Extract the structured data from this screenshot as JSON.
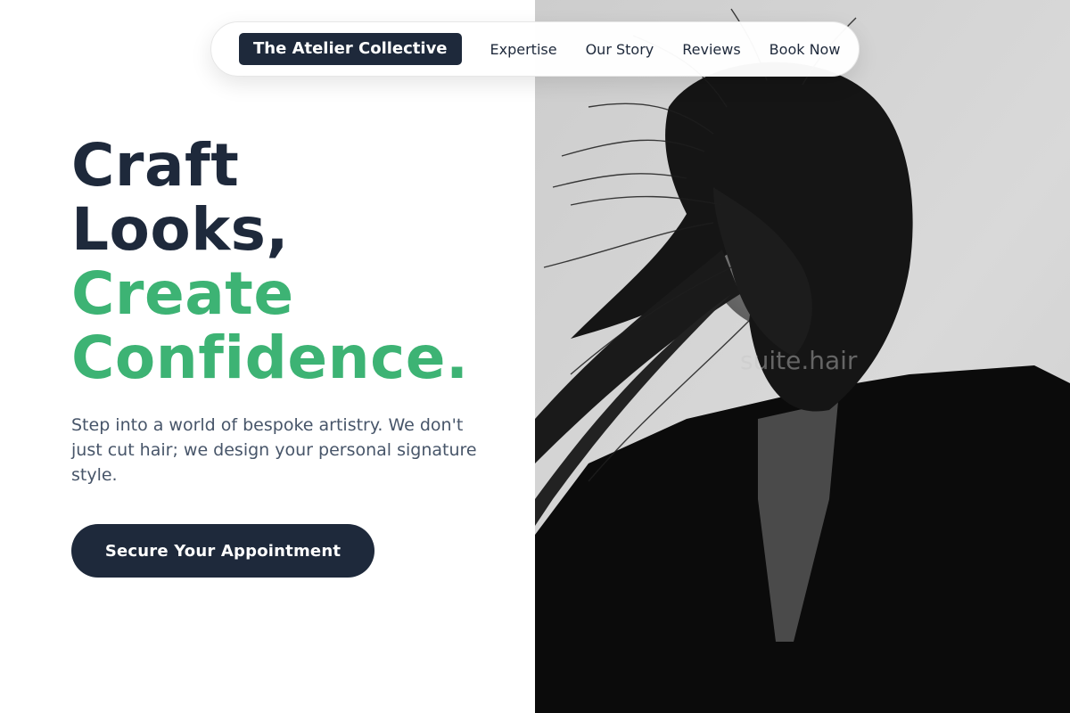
{
  "nav": {
    "brand": "The Atelier Collective",
    "links": [
      "Expertise",
      "Our Story",
      "Reviews",
      "Book Now"
    ]
  },
  "hero": {
    "headline_line1": "Craft",
    "headline_line2": "Looks,",
    "headline_line3": "Create",
    "headline_line4": "Confidence.",
    "subtext": "Step into a world of bespoke artistry. We don't just cut hair; we design your personal signature style.",
    "cta_label": "Secure Your Appointment"
  },
  "photo": {
    "watermark": "suite.hair"
  },
  "colors": {
    "dark": "#1e293b",
    "accent_green": "#3db374",
    "body_text": "#475569",
    "background": "#ffffff"
  }
}
